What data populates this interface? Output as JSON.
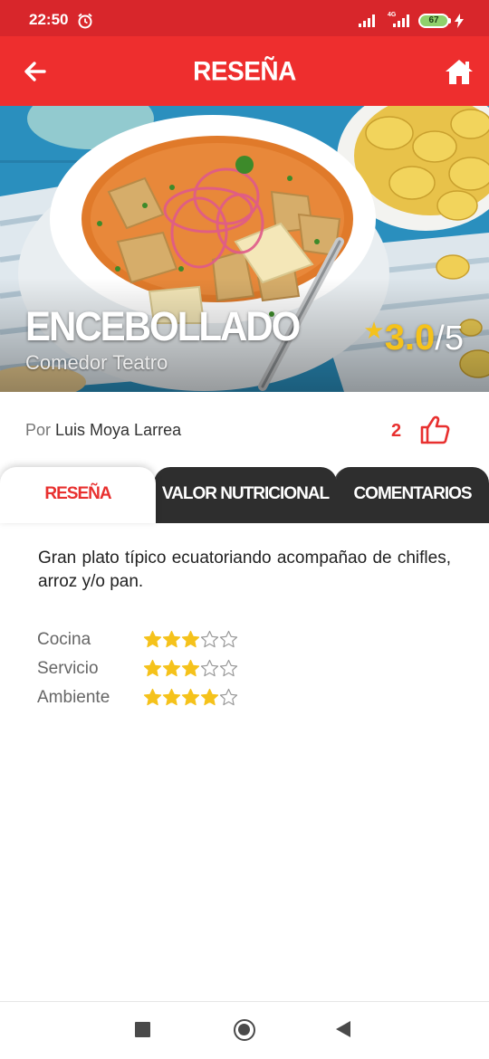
{
  "status_bar": {
    "time": "22:50",
    "network": "4G",
    "battery": "67"
  },
  "app_bar": {
    "title": "RESEÑA"
  },
  "hero": {
    "dish_name": "ENCEBOLLADO",
    "restaurant": "Comedor Teatro",
    "rating_value": "3.0",
    "rating_max": "/5"
  },
  "author": {
    "prefix": "Por ",
    "name": "Luis Moya Larrea",
    "likes": "2"
  },
  "tabs": [
    {
      "label": "RESEÑA",
      "active": true
    },
    {
      "label": "VALOR NUTRICIONAL",
      "active": false
    },
    {
      "label": "COMENTARIOS",
      "active": false
    }
  ],
  "review": {
    "description": "Gran plato típico ecuatoriando acompañao de chifles, arroz y/o pan.",
    "ratings": [
      {
        "label": "Cocina",
        "stars": 3,
        "max": 5
      },
      {
        "label": "Servicio",
        "stars": 3,
        "max": 5
      },
      {
        "label": "Ambiente",
        "stars": 4,
        "max": 5
      }
    ]
  },
  "colors": {
    "status_bar": "#d8262b",
    "app_bar": "#ee2e2e",
    "accent_red": "#e8302f",
    "star_yellow": "#f5c21b",
    "tab_dark": "#2e2e2e"
  }
}
